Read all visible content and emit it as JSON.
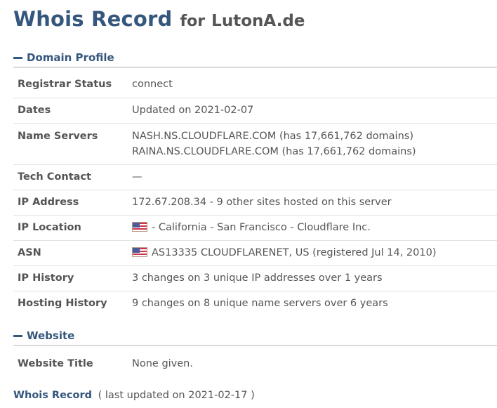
{
  "header": {
    "title": "Whois Record",
    "for": "for",
    "domain": "LutonA.de"
  },
  "domain_profile": {
    "heading": "Domain Profile",
    "rows": [
      {
        "label": "Registrar Status",
        "value": "connect"
      },
      {
        "label": "Dates",
        "value": "Updated on 2021-02-07"
      },
      {
        "label": "Name Servers",
        "values": [
          "NASH.NS.CLOUDFLARE.COM (has 17,661,762 domains)",
          "RAINA.NS.CLOUDFLARE.COM (has 17,661,762 domains)"
        ]
      },
      {
        "label": "Tech Contact",
        "value": "—"
      },
      {
        "label": "IP Address",
        "value": "172.67.208.34 - 9 other sites hosted on this server"
      },
      {
        "label": "IP Location",
        "value": "- California - San Francisco - Cloudflare Inc.",
        "icon": "us-flag-icon"
      },
      {
        "label": "ASN",
        "value": "AS13335 CLOUDFLARENET, US (registered Jul 14, 2010)",
        "icon": "us-flag-icon"
      },
      {
        "label": "IP History",
        "value": "3 changes on 3 unique IP addresses over 1 years"
      },
      {
        "label": "Hosting History",
        "value": "9 changes on 8 unique name servers over 6 years"
      }
    ]
  },
  "website": {
    "heading": "Website",
    "rows": [
      {
        "label": "Website Title",
        "value": "None given."
      }
    ]
  },
  "footer": {
    "title": "Whois Record",
    "meta": "( last updated on 2021-02-17 )"
  },
  "colors": {
    "accent": "#35577d",
    "text": "#555555",
    "divider": "#e2e2e2"
  }
}
